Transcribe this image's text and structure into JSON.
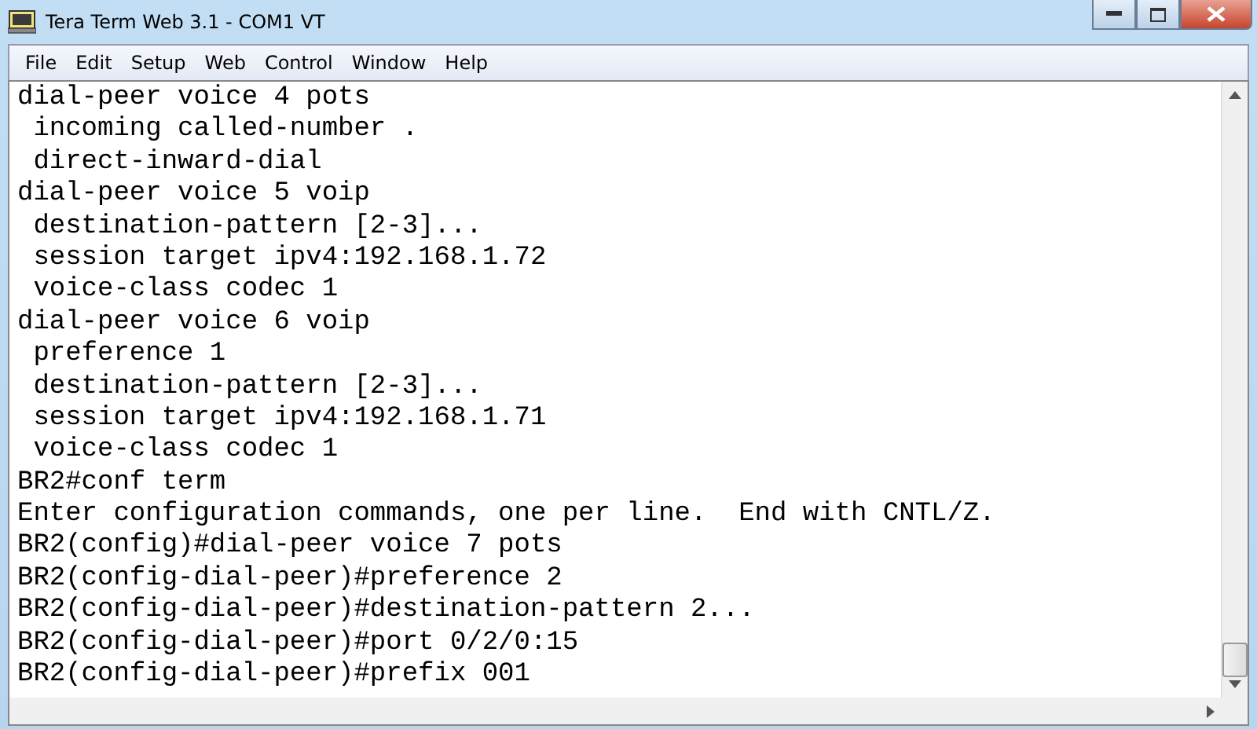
{
  "window": {
    "title": "Tera Term Web 3.1 - COM1 VT"
  },
  "menu": [
    "File",
    "Edit",
    "Setup",
    "Web",
    "Control",
    "Window",
    "Help"
  ],
  "terminal_lines": [
    "dial-peer voice 4 pots",
    " incoming called-number .",
    " direct-inward-dial",
    "dial-peer voice 5 voip",
    " destination-pattern [2-3]...",
    " session target ipv4:192.168.1.72",
    " voice-class codec 1",
    "dial-peer voice 6 voip",
    " preference 1",
    " destination-pattern [2-3]...",
    " session target ipv4:192.168.1.71",
    " voice-class codec 1",
    "BR2#conf term",
    "Enter configuration commands, one per line.  End with CNTL/Z.",
    "BR2(config)#dial-peer voice 7 pots",
    "BR2(config-dial-peer)#preference 2",
    "BR2(config-dial-peer)#destination-pattern 2...",
    "BR2(config-dial-peer)#port 0/2/0:15",
    "BR2(config-dial-peer)#prefix 001"
  ]
}
